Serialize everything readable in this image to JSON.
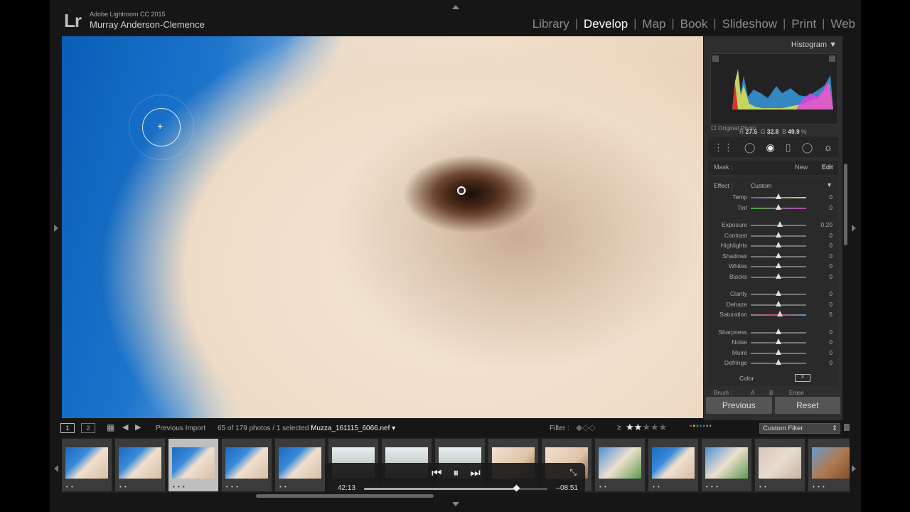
{
  "app": {
    "logo": "Lr",
    "product": "Adobe Lightroom CC 2015",
    "user": "Murray Anderson-Clemence"
  },
  "modules": [
    {
      "label": "Library",
      "active": false
    },
    {
      "label": "Develop",
      "active": true
    },
    {
      "label": "Map",
      "active": false
    },
    {
      "label": "Book",
      "active": false
    },
    {
      "label": "Slideshow",
      "active": false
    },
    {
      "label": "Print",
      "active": false
    },
    {
      "label": "Web",
      "active": false
    }
  ],
  "panel": {
    "histogram_title": "Histogram",
    "rgb": {
      "r_label": "R",
      "r": "27.5",
      "g_label": "G",
      "g": "32.8",
      "b_label": "B",
      "b": "49.9",
      "unit": "%"
    },
    "original_photo": "Original Photo",
    "mask_label": "Mask :",
    "mask_new": "New",
    "mask_edit": "Edit",
    "effect_label": "Effect :",
    "effect_value": "Custom",
    "sliders": [
      {
        "label": "Temp",
        "value": "0",
        "pos": 0.5,
        "group": 1
      },
      {
        "label": "Tint",
        "value": "0",
        "pos": 0.5,
        "group": 1
      },
      {
        "label": "Exposure",
        "value": "0.20",
        "pos": 0.52,
        "group": 2
      },
      {
        "label": "Contrast",
        "value": "0",
        "pos": 0.5,
        "group": 2
      },
      {
        "label": "Highlights",
        "value": "0",
        "pos": 0.5,
        "group": 2
      },
      {
        "label": "Shadows",
        "value": "0",
        "pos": 0.5,
        "group": 2
      },
      {
        "label": "Whites",
        "value": "0",
        "pos": 0.5,
        "group": 2
      },
      {
        "label": "Blacks",
        "value": "0",
        "pos": 0.5,
        "group": 2
      },
      {
        "label": "Clarity",
        "value": "0",
        "pos": 0.5,
        "group": 3
      },
      {
        "label": "Dehaze",
        "value": "0",
        "pos": 0.5,
        "group": 3
      },
      {
        "label": "Saturation",
        "value": "5",
        "pos": 0.53,
        "group": 3
      },
      {
        "label": "Sharpness",
        "value": "0",
        "pos": 0.5,
        "group": 4
      },
      {
        "label": "Noise",
        "value": "0",
        "pos": 0.5,
        "group": 4
      },
      {
        "label": "Moiré",
        "value": "0",
        "pos": 0.5,
        "group": 4
      },
      {
        "label": "Defringe",
        "value": "0",
        "pos": 0.5,
        "group": 4
      }
    ],
    "color_label": "Color",
    "brush_label": "Brush :",
    "brush_a": "A",
    "brush_b": "B",
    "brush_erase": "Erase",
    "previous_button": "Previous",
    "reset_button": "Reset"
  },
  "filmstrip": {
    "view1": "1",
    "view2": "2",
    "source": "Previous Import",
    "count": "65 of 179 photos / 1 selected /",
    "filename": "Muzza_161115_6066.nef",
    "filter_label": "Filter :",
    "rating_op": "≥",
    "stars_filled": 2,
    "stars_total": 5,
    "custom_filter": "Custom Filter",
    "thumbnails": [
      {
        "dots": "• •",
        "selected": false,
        "tone": "horse"
      },
      {
        "dots": "• •",
        "selected": false,
        "tone": "horse"
      },
      {
        "dots": "• • •",
        "selected": true,
        "tone": "horse"
      },
      {
        "dots": "• • •",
        "selected": false,
        "tone": "horse"
      },
      {
        "dots": "• •",
        "selected": false,
        "tone": "horse"
      },
      {
        "dots": "",
        "selected": false,
        "tone": "trees"
      },
      {
        "dots": "",
        "selected": false,
        "tone": "trees"
      },
      {
        "dots": "",
        "selected": false,
        "tone": "trees"
      },
      {
        "dots": "",
        "selected": false,
        "tone": "close"
      },
      {
        "dots": "",
        "selected": false,
        "tone": "close"
      },
      {
        "dots": "• •",
        "selected": false,
        "tone": "green"
      },
      {
        "dots": "• •",
        "selected": false,
        "tone": "horse"
      },
      {
        "dots": "• • •",
        "selected": false,
        "tone": "green"
      },
      {
        "dots": "• •",
        "selected": false,
        "tone": "fog"
      },
      {
        "dots": "• • •",
        "selected": false,
        "tone": "brown"
      }
    ]
  },
  "video": {
    "elapsed": "42:13",
    "remaining": "–08:51",
    "progress": 0.83
  }
}
